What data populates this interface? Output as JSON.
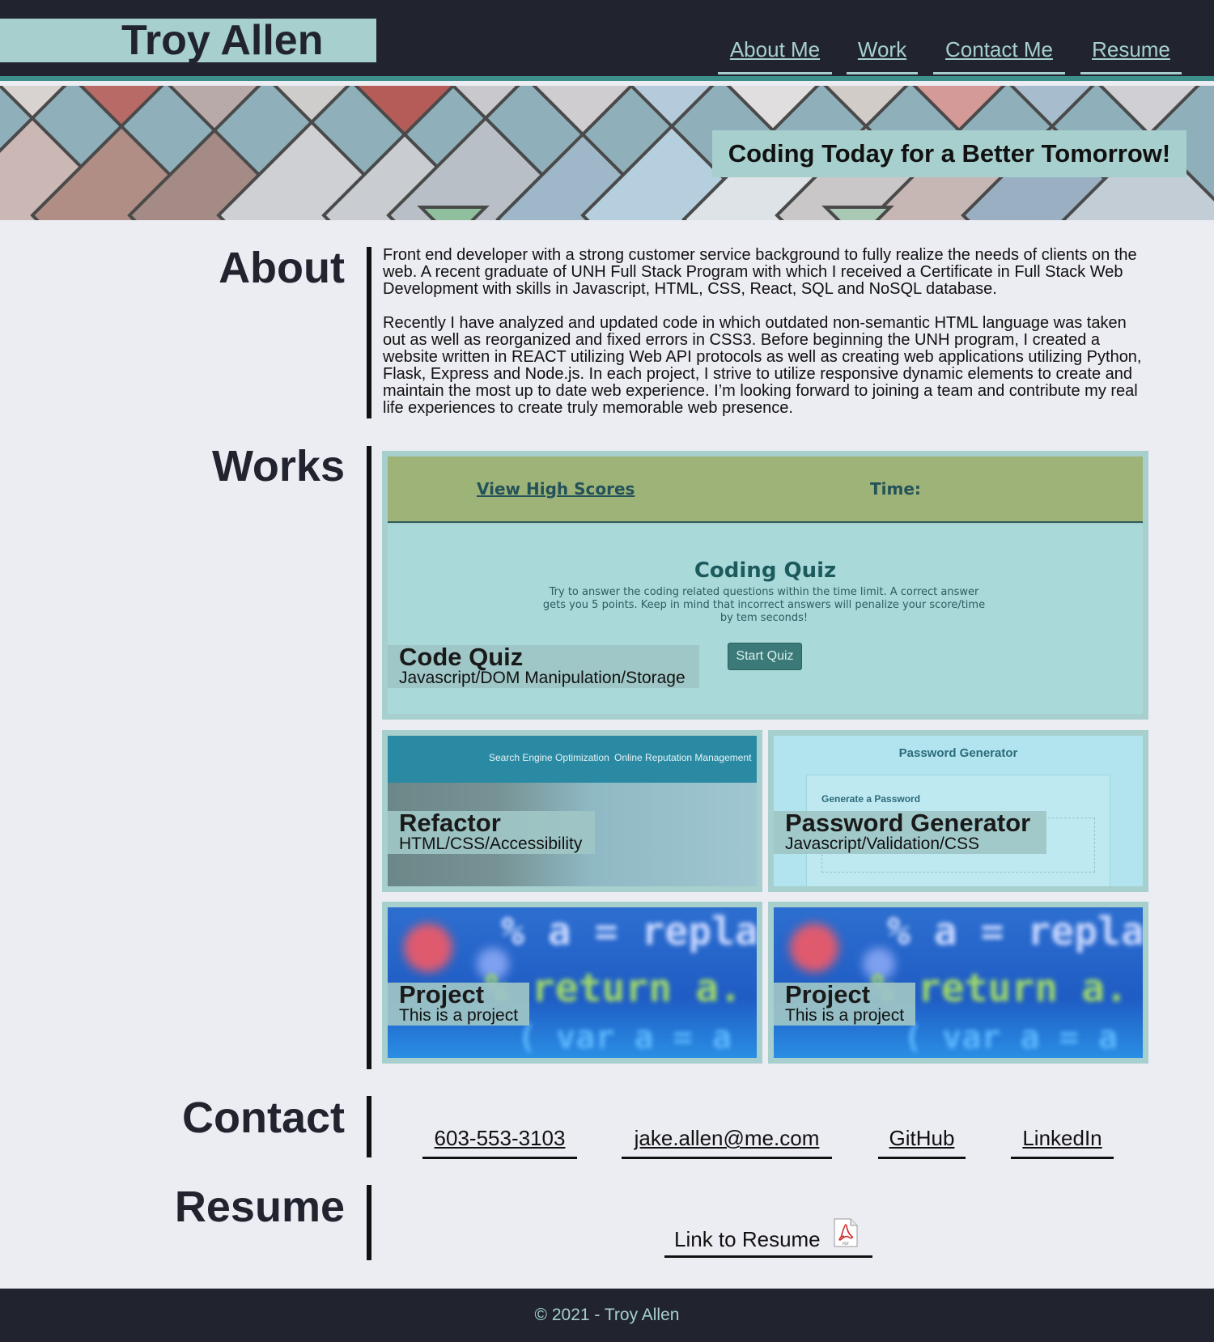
{
  "header": {
    "name": "Troy Allen",
    "nav": [
      "About Me",
      "Work",
      "Contact Me",
      "Resume"
    ]
  },
  "hero": {
    "tagline": "Coding Today for a Better Tomorrow!"
  },
  "about": {
    "title": "About",
    "paragraphs": [
      "Front end developer with a strong customer service background to fully realize the needs of clients on the web. A recent graduate of UNH Full Stack Program with which I received a Certificate in Full Stack Web Development with skills in Javascript, HTML, CSS, React, SQL and NoSQL database.",
      "Recently I have analyzed and updated code in which outdated non-semantic HTML language was taken out as well as reorganized and fixed errors in CSS3. Before beginning the UNH program, I created a website written in REACT utilizing Web API protocols as well as creating web applications utilizing Python, Flask, Express and Node.js. In each project, I strive to utilize responsive dynamic elements to create and maintain the most up to date web experience. I’m looking forward to joining a team and contribute my real life experiences to create truly memorable web presence."
    ]
  },
  "works": {
    "title": "Works",
    "quiz_preview": {
      "high_scores": "View High Scores",
      "time": "Time:",
      "title": "Coding Quiz",
      "desc": "Try to answer the coding related questions within the time limit. A correct answer gets you 5 points. Keep in mind that incorrect answers will penalize your score/time by tem seconds!",
      "button": "Start Quiz"
    },
    "refactor_preview": {
      "nav1": "Search Engine Optimization",
      "nav2": "Online Reputation Management"
    },
    "password_preview": {
      "title": "Password Generator",
      "box_label": "Generate a Password"
    },
    "code_preview": {
      "text1": "% a = replace",
      "text2": "% return a.",
      "text3": "( var a = a"
    },
    "items": [
      {
        "title": "Code Quiz",
        "subtitle": "Javascript/DOM Manipulation/Storage"
      },
      {
        "title": "Refactor",
        "subtitle": "HTML/CSS/Accessibility"
      },
      {
        "title": "Password Generator",
        "subtitle": "Javascript/Validation/CSS"
      },
      {
        "title": "Project",
        "subtitle": "This is a project"
      },
      {
        "title": "Project",
        "subtitle": "This is a project"
      }
    ]
  },
  "contact": {
    "title": "Contact",
    "links": [
      "603-553-3103",
      "jake.allen@me.com",
      "GitHub",
      "LinkedIn"
    ]
  },
  "resume": {
    "title": "Resume",
    "link": "Link to Resume",
    "icon_label": "PDF"
  },
  "footer": {
    "text": "© 2021 - Troy Allen"
  },
  "colors": {
    "dark": "#21242e",
    "accent": "#a6cfcd",
    "teal_line": "#3d8f8a",
    "page_bg": "#ececf3"
  },
  "icons": {
    "resume": "pdf-file-icon"
  }
}
